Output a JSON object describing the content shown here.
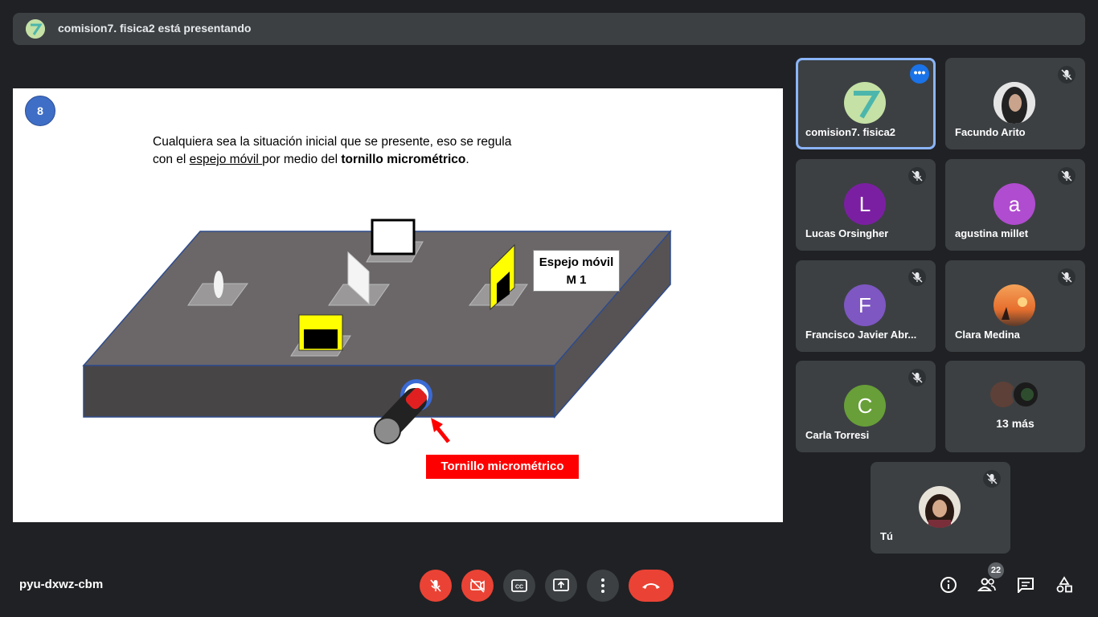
{
  "banner": {
    "text": "comision7. fisica2 está presentando"
  },
  "slide": {
    "number": "8",
    "line1": "Cualquiera sea la situación inicial que se presente, eso se regula",
    "line2_prefix": "con el ",
    "line2_underlined": "espejo móvil ",
    "line2_middle": "por medio del ",
    "line2_bold": "tornillo micrométrico",
    "line2_suffix": ".",
    "mirror_label_line1": "Espejo móvil",
    "mirror_label_line2": "M 1",
    "screw_label": "Tornillo micrométrico"
  },
  "participants": [
    {
      "name": "comision7. fisica2",
      "avatar": "image",
      "active": true
    },
    {
      "name": "Facundo Arito",
      "avatar": "image",
      "muted": true
    },
    {
      "name": "Lucas Orsingher",
      "initial": "L",
      "color": "#7b1fa2",
      "muted": true
    },
    {
      "name": "agustina millet",
      "initial": "a",
      "color": "#b04ccf",
      "muted": true
    },
    {
      "name": "Francisco Javier Abr...",
      "initial": "F",
      "color": "#7e57c2",
      "muted": true
    },
    {
      "name": "Clara Medina",
      "avatar": "image",
      "muted": true
    },
    {
      "name": "Carla Torresi",
      "initial": "C",
      "color": "#689f38",
      "muted": true
    },
    {
      "more": "13 más"
    },
    {
      "name": "Tú",
      "avatar": "image",
      "muted": true
    }
  ],
  "footer": {
    "meeting_code": "pyu-dxwz-cbm",
    "people_count": "22"
  },
  "colors": {
    "background": "#202124",
    "tile": "#3c4043",
    "accent": "#1a73e8",
    "danger": "#ea4335"
  }
}
